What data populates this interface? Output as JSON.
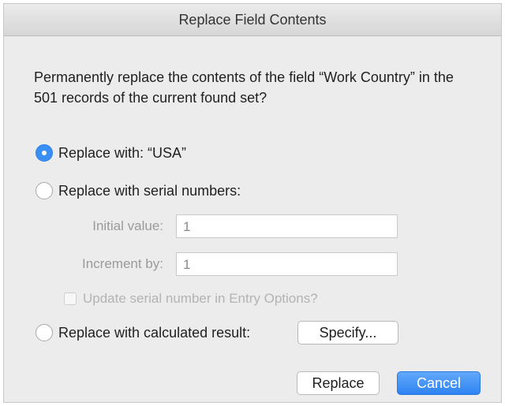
{
  "dialog": {
    "title": "Replace Field Contents",
    "message": "Permanently replace the contents of the field “Work Country” in the 501 records of the current found set?"
  },
  "options": {
    "replace_with": {
      "label": "Replace with: “USA”",
      "selected": true
    },
    "serial_numbers": {
      "label": "Replace with serial numbers:",
      "selected": false,
      "initial_value_label": "Initial value:",
      "initial_value": "1",
      "increment_label": "Increment by:",
      "increment_value": "1",
      "update_label": "Update serial number in Entry Options?",
      "update_checked": false
    },
    "calculated": {
      "label": "Replace with calculated result:",
      "selected": false,
      "specify_label": "Specify..."
    }
  },
  "buttons": {
    "replace_label": "Replace",
    "cancel_label": "Cancel"
  },
  "colors": {
    "accent": "#3a8ff5",
    "dialog_bg": "#ececec",
    "disabled_text": "#9a9a9a"
  }
}
